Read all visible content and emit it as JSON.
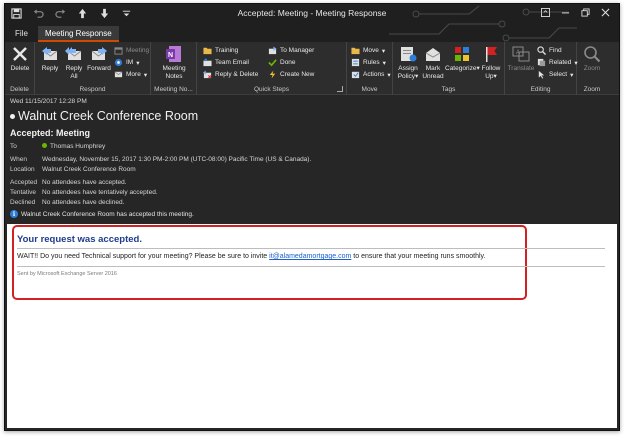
{
  "window": {
    "title": "Accepted: Meeting  -  Meeting Response"
  },
  "tabs": [
    {
      "label": "File",
      "active": false
    },
    {
      "label": "Meeting Response",
      "active": true
    }
  ],
  "ribbon": {
    "delete_group": {
      "label": "Delete",
      "delete": "Delete"
    },
    "respond_group": {
      "label": "Respond",
      "reply": "Reply",
      "reply_all_1": "Reply",
      "reply_all_2": "All",
      "forward": "Forward",
      "meeting": "Meeting",
      "im": "IM",
      "more": "More"
    },
    "meeting_notes_group": {
      "label": "Meeting No...",
      "line1": "Meeting",
      "line2": "Notes"
    },
    "quick_steps_group": {
      "label": "Quick Steps",
      "training": "Training",
      "team_email": "Team Email",
      "reply_delete": "Reply & Delete",
      "to_manager": "To Manager",
      "done": "Done",
      "create_new": "Create New"
    },
    "move_group": {
      "label": "Move",
      "move": "Move",
      "rules": "Rules",
      "actions": "Actions"
    },
    "tags_group": {
      "label": "Tags",
      "assign_policy_1": "Assign",
      "assign_policy_2": "Policy",
      "mark_unread_1": "Mark",
      "mark_unread_2": "Unread",
      "categorize": "Categorize",
      "follow_up_1": "Follow",
      "follow_up_2": "Up"
    },
    "editing_group": {
      "label": "Editing",
      "translate": "Translate",
      "find": "Find",
      "related": "Related",
      "select": "Select"
    },
    "zoom_group": {
      "label": "Zoom",
      "zoom": "Zoom"
    }
  },
  "message": {
    "sent_date": "Wed 11/15/2017 12:28 PM",
    "subject": "Walnut Creek Conference Room",
    "response_title": "Accepted: Meeting",
    "to_label": "To",
    "to_value": "Thomas Humphrey",
    "when_label": "When",
    "when_value": "Wednesday, November 15, 2017 1:30 PM-2:00 PM (UTC-08:00) Pacific Time (US & Canada).",
    "location_label": "Location",
    "location_value": "Walnut Creek Conference Room",
    "accepted_label": "Accepted",
    "accepted_value": "No attendees have accepted.",
    "tentative_label": "Tentative",
    "tentative_value": "No attendees have tentatively accepted.",
    "declined_label": "Declined",
    "declined_value": "No attendees have declined.",
    "info_text": "Walnut Creek Conference Room has accepted this meeting."
  },
  "body": {
    "request_title": "Your request was accepted.",
    "wait_before": "WAIT!! Do you need Technical support for your meeting? Please be sure to invite ",
    "email_link": "it@alamedamortgage.com",
    "wait_after": " to ensure that your meeting runs smoothly.",
    "sent_by": "Sent by Microsoft Exchange Server 2016"
  },
  "colors": {
    "accent_orange": "#d04a02",
    "highlight_red": "#d32020",
    "title_blue": "#1f3b8c",
    "link_blue": "#1a5fcc"
  }
}
